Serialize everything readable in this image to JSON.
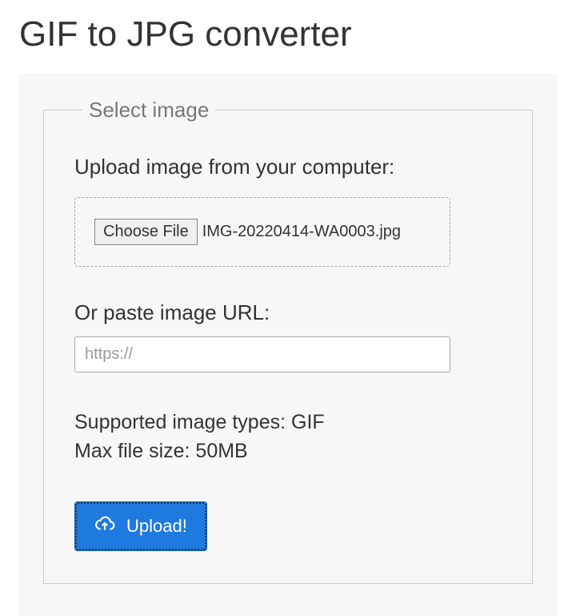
{
  "page": {
    "title": "GIF to JPG converter"
  },
  "form": {
    "legend": "Select image",
    "upload_label": "Upload image from your computer:",
    "choose_file_button": "Choose File",
    "chosen_filename": "IMG-20220414-WA0003.jpg",
    "url_label": "Or paste image URL:",
    "url_placeholder": "https://",
    "url_value": "",
    "supported_types": "Supported image types: GIF",
    "max_size": "Max file size: 50MB",
    "upload_button": "Upload!"
  }
}
